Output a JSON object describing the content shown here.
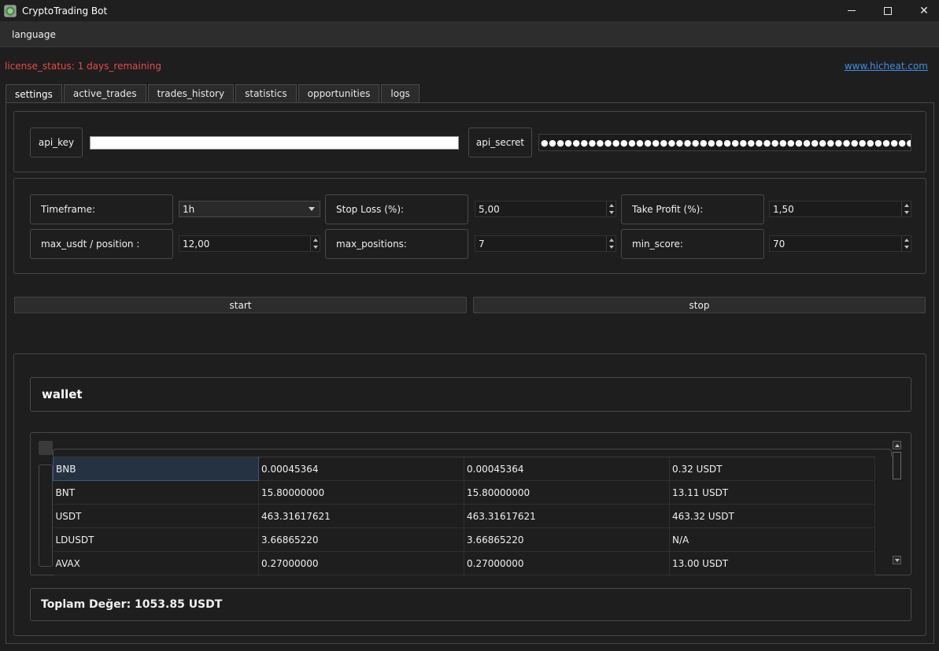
{
  "window": {
    "title": "CryptoTrading Bot",
    "app_icon": "app-logo-icon"
  },
  "menu": {
    "items": [
      "language"
    ]
  },
  "license_status": "license_status: 1 days_remaining",
  "website": "www.hicheat.com",
  "tabs": [
    {
      "label": "settings",
      "active": true
    },
    {
      "label": "active_trades",
      "active": false
    },
    {
      "label": "trades_history",
      "active": false
    },
    {
      "label": "statistics",
      "active": false
    },
    {
      "label": "opportunities",
      "active": false
    },
    {
      "label": "logs",
      "active": false
    }
  ],
  "api": {
    "key_label": "api_key",
    "key_value": "",
    "secret_label": "api_secret",
    "secret_value": "●●●●●●●●●●●●●●●●●●●●●●●●●●●●●●●●●●●●●●●●●●●●●●●●●●●●●●●●●●●●●●●●"
  },
  "params": {
    "timeframe_label": "Timeframe:",
    "timeframe_value": "1h",
    "stop_loss_label": "Stop Loss (%):",
    "stop_loss_value": "5,00",
    "take_profit_label": "Take Profit (%):",
    "take_profit_value": "1,50",
    "max_usdt_label": "max_usdt / position :",
    "max_usdt_value": "12,00",
    "max_positions_label": "max_positions:",
    "max_positions_value": "7",
    "min_score_label": "min_score:",
    "min_score_value": "70"
  },
  "controls": {
    "start_label": "start",
    "stop_label": "stop"
  },
  "wallet": {
    "title": "wallet",
    "rows": [
      [
        "BNB",
        "0.00045364",
        "0.00045364",
        "0.32 USDT"
      ],
      [
        "BNT",
        "15.80000000",
        "15.80000000",
        "13.11 USDT"
      ],
      [
        "USDT",
        "463.31617621",
        "463.31617621",
        "463.32 USDT"
      ],
      [
        "LDUSDT",
        "3.66865220",
        "3.66865220",
        "N/A"
      ],
      [
        "AVAX",
        "0.27000000",
        "0.27000000",
        "13.00 USDT"
      ]
    ],
    "total_label": "Toplam Değer: 1053.85 USDT"
  },
  "colors": {
    "background": "#1e1e1e",
    "license_text": "#e84a4a",
    "link": "#3f8fe0",
    "selected_cell": "#253241"
  }
}
